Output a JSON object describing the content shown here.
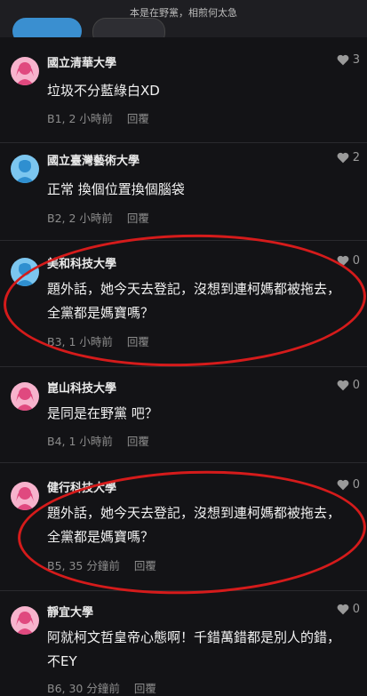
{
  "header": {
    "title": "本是在野黨，相煎何太急",
    "chip_a": "",
    "chip_b": ""
  },
  "comments": [
    {
      "school": "國立清華大學",
      "avatar": "female-avatar",
      "likes": "3",
      "text": "垃圾不分藍綠白XD",
      "floor": "B1, 2 小時前",
      "reply": "回覆"
    },
    {
      "school": "國立臺灣藝術大學",
      "avatar": "male-avatar",
      "likes": "2",
      "text": "正常 換個位置換個腦袋",
      "floor": "B2, 2 小時前",
      "reply": "回覆"
    },
    {
      "school": "美和科技大學",
      "avatar": "male-avatar",
      "likes": "0",
      "text": "題外話，她今天去登記，沒想到連柯媽都被拖去，全黨都是媽寶嗎？",
      "floor": "B3, 1 小時前",
      "reply": "回覆"
    },
    {
      "school": "崑山科技大學",
      "avatar": "female-avatar",
      "likes": "0",
      "text": "是同是在野黨 吧？",
      "floor": "B4, 1 小時前",
      "reply": "回覆"
    },
    {
      "school": "健行科技大學",
      "avatar": "female-avatar",
      "likes": "0",
      "text": "題外話，她今天去登記，沒想到連柯媽都被拖去，全黨都是媽寶嗎？",
      "floor": "B5, 35 分鐘前",
      "reply": "回覆"
    },
    {
      "school": "靜宜大學",
      "avatar": "female-avatar",
      "likes": "0",
      "text": "阿就柯文哲皇帝心態啊！千錯萬錯都是別人的錯，不EY",
      "floor": "B6, 30 分鐘前",
      "reply": "回覆"
    }
  ],
  "colors": {
    "background": "#131316",
    "annotation": "#d51b1b",
    "avatar_pink": "#f7b3cd",
    "avatar_blue": "#7cc6ef"
  }
}
